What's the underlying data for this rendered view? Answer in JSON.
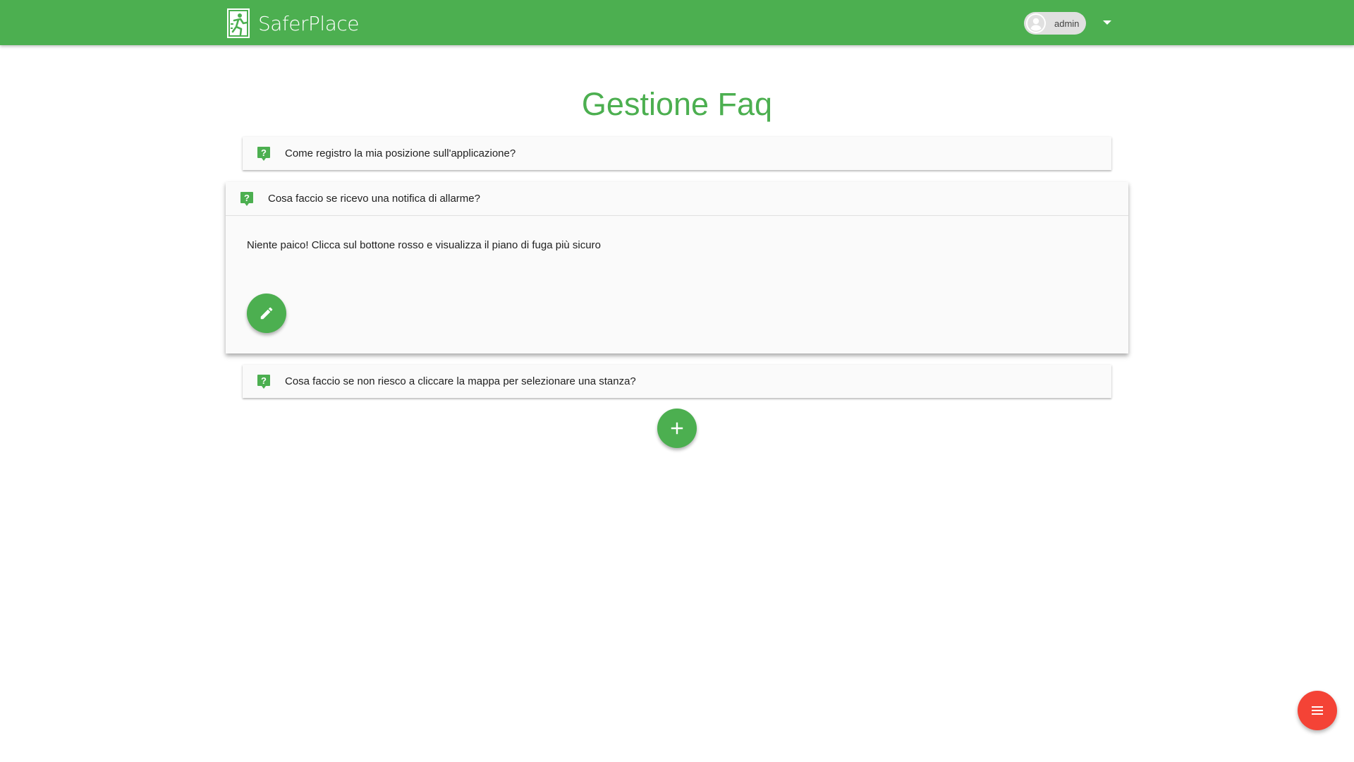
{
  "header": {
    "brand_name": "SaferPlace",
    "user_name": "admin",
    "brand_color": "#4caf50"
  },
  "page": {
    "title": "Gestione Faq"
  },
  "faqs": [
    {
      "question": "Come registro la mia posizione sull'applicazione?",
      "expanded": false
    },
    {
      "question": "Cosa faccio se ricevo una notifica di allarme?",
      "answer": "Niente paico! Clicca sul bottone rosso e visualizza il piano di fuga più sicuro",
      "expanded": true
    },
    {
      "question": "Cosa faccio se non riesco a cliccare la mappa per selezionare una stanza?",
      "expanded": false
    }
  ],
  "icons": {
    "brand": "emergency-exit-logo",
    "user": "account-circle-icon",
    "dropdown": "arrow-drop-down-icon",
    "faq": "help-question-icon",
    "edit": "pencil-icon",
    "add": "plus-icon",
    "menu": "menu-icon"
  },
  "colors": {
    "primary": "#4caf50",
    "accent": "#f44336",
    "panel_bg": "#fafafa"
  }
}
